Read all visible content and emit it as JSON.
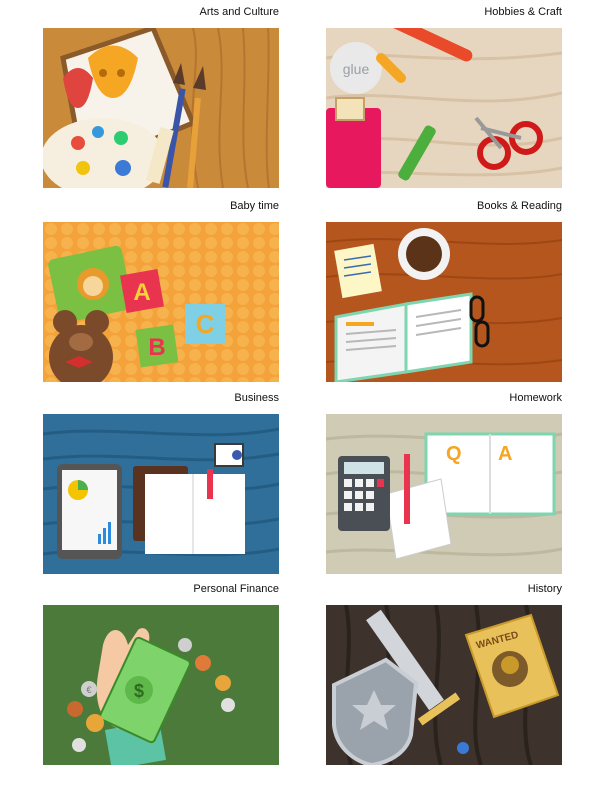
{
  "categories": [
    {
      "label": "Arts and Culture",
      "icon": "palette-and-masks-icon"
    },
    {
      "label": "Hobbies & Craft",
      "icon": "glue-and-scissors-icon"
    },
    {
      "label": "Baby time",
      "icon": "teddy-bear-and-blocks-icon"
    },
    {
      "label": "Books & Reading",
      "icon": "book-and-coffee-icon"
    },
    {
      "label": "Business",
      "icon": "tablet-and-planner-icon"
    },
    {
      "label": "Homework",
      "icon": "calculator-and-qa-book-icon"
    },
    {
      "label": "Personal Finance",
      "icon": "hand-with-money-icon"
    },
    {
      "label": "History",
      "icon": "shield-and-sword-icon"
    }
  ],
  "illustration_text": {
    "glue": "glue",
    "block_a": "A",
    "block_b": "B",
    "block_c": "C",
    "book_q": "Q",
    "book_a": "A",
    "poster": "WANTED",
    "currency": "$",
    "euro": "€"
  },
  "colors": {
    "wood_orange": "#c98a3a",
    "wood_light": "#e7d6bf",
    "baby_orange": "#f4a23a",
    "wood_brown": "#b4561d",
    "water_blue": "#2f6f99",
    "khaki": "#cfcbb5",
    "grass_green": "#4c7a3a",
    "dark_bark": "#3d332c"
  }
}
